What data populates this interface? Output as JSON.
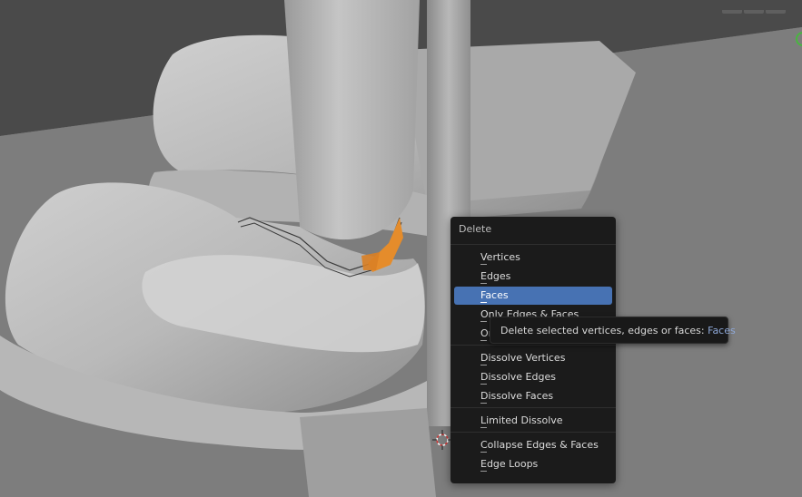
{
  "menu": {
    "title": "Delete",
    "groups": [
      [
        "Vertices",
        "Edges",
        "Faces",
        "Only Edges & Faces",
        "Only Faces"
      ],
      [
        "Dissolve Vertices",
        "Dissolve Edges",
        "Dissolve Faces"
      ],
      [
        "Limited Dissolve"
      ],
      [
        "Collapse Edges & Faces",
        "Edge Loops"
      ]
    ],
    "active": "Faces"
  },
  "tooltip": {
    "text": "Delete selected vertices, edges or faces:",
    "value": "Faces"
  },
  "colors": {
    "menu_bg": "#1b1b1b",
    "highlight": "#4772b3",
    "selection": "#e58c2b",
    "tooltip_value": "#8ea8d8"
  }
}
